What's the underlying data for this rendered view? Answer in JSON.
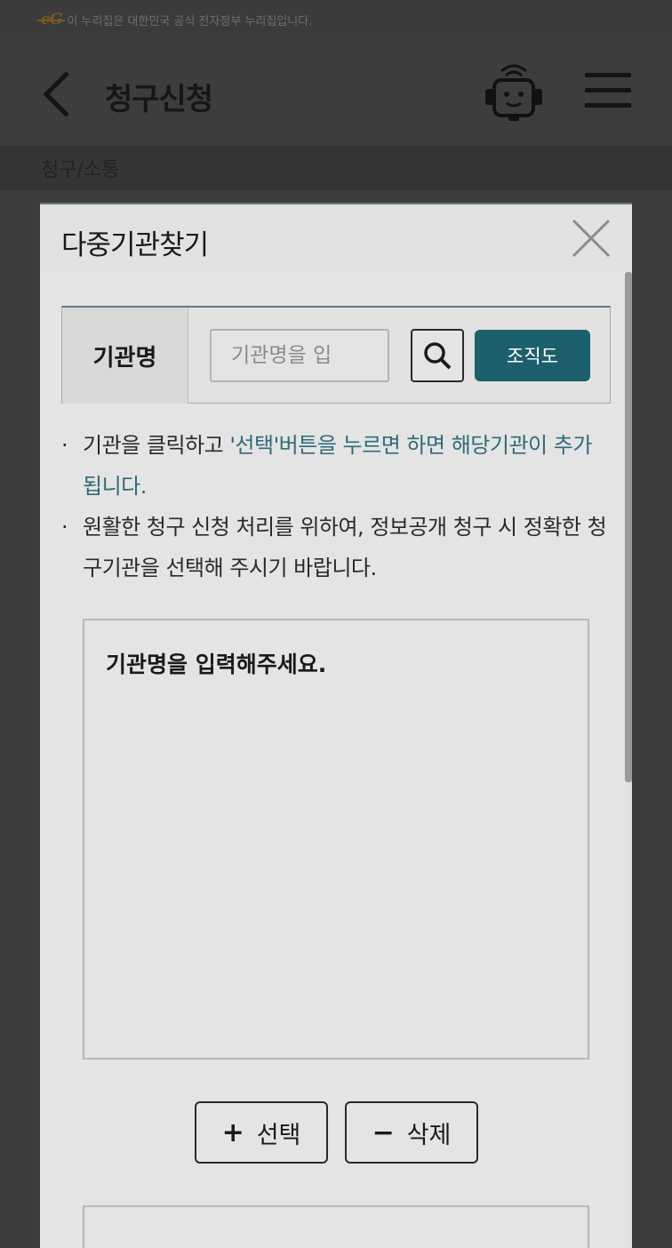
{
  "gov_banner": {
    "logo": "eG",
    "text": "이 누리집은 대한민국 공식 전자정부 누리집입니다."
  },
  "header": {
    "title": "청구신청"
  },
  "breadcrumb": {
    "label": "청구/소통"
  },
  "modal": {
    "title": "다중기관찾기",
    "search": {
      "label": "기관명",
      "placeholder": "기관명을 입",
      "value": "",
      "org_chart_label": "조직도"
    },
    "notices": {
      "first_pre": "기관을 클릭하고 ",
      "first_highlight": "'선택'버튼을 누르면 하면 해당기관이 추가됩니다.",
      "second": "원활한 청구 신청 처리를 위하여, 정보공개 청구 시 정확한 청구기관을 선택해 주시기 바랍니다."
    },
    "bullet": "·",
    "result_message": "기관명을 입력해주세요.",
    "add_button": {
      "symbol": "+",
      "label": "선택"
    },
    "delete_button": {
      "symbol": "−",
      "label": "삭제"
    }
  },
  "colors": {
    "accent": "#1c5f6d",
    "highlight_text": "#2e6b78",
    "overlay": "#3d3d3d"
  }
}
